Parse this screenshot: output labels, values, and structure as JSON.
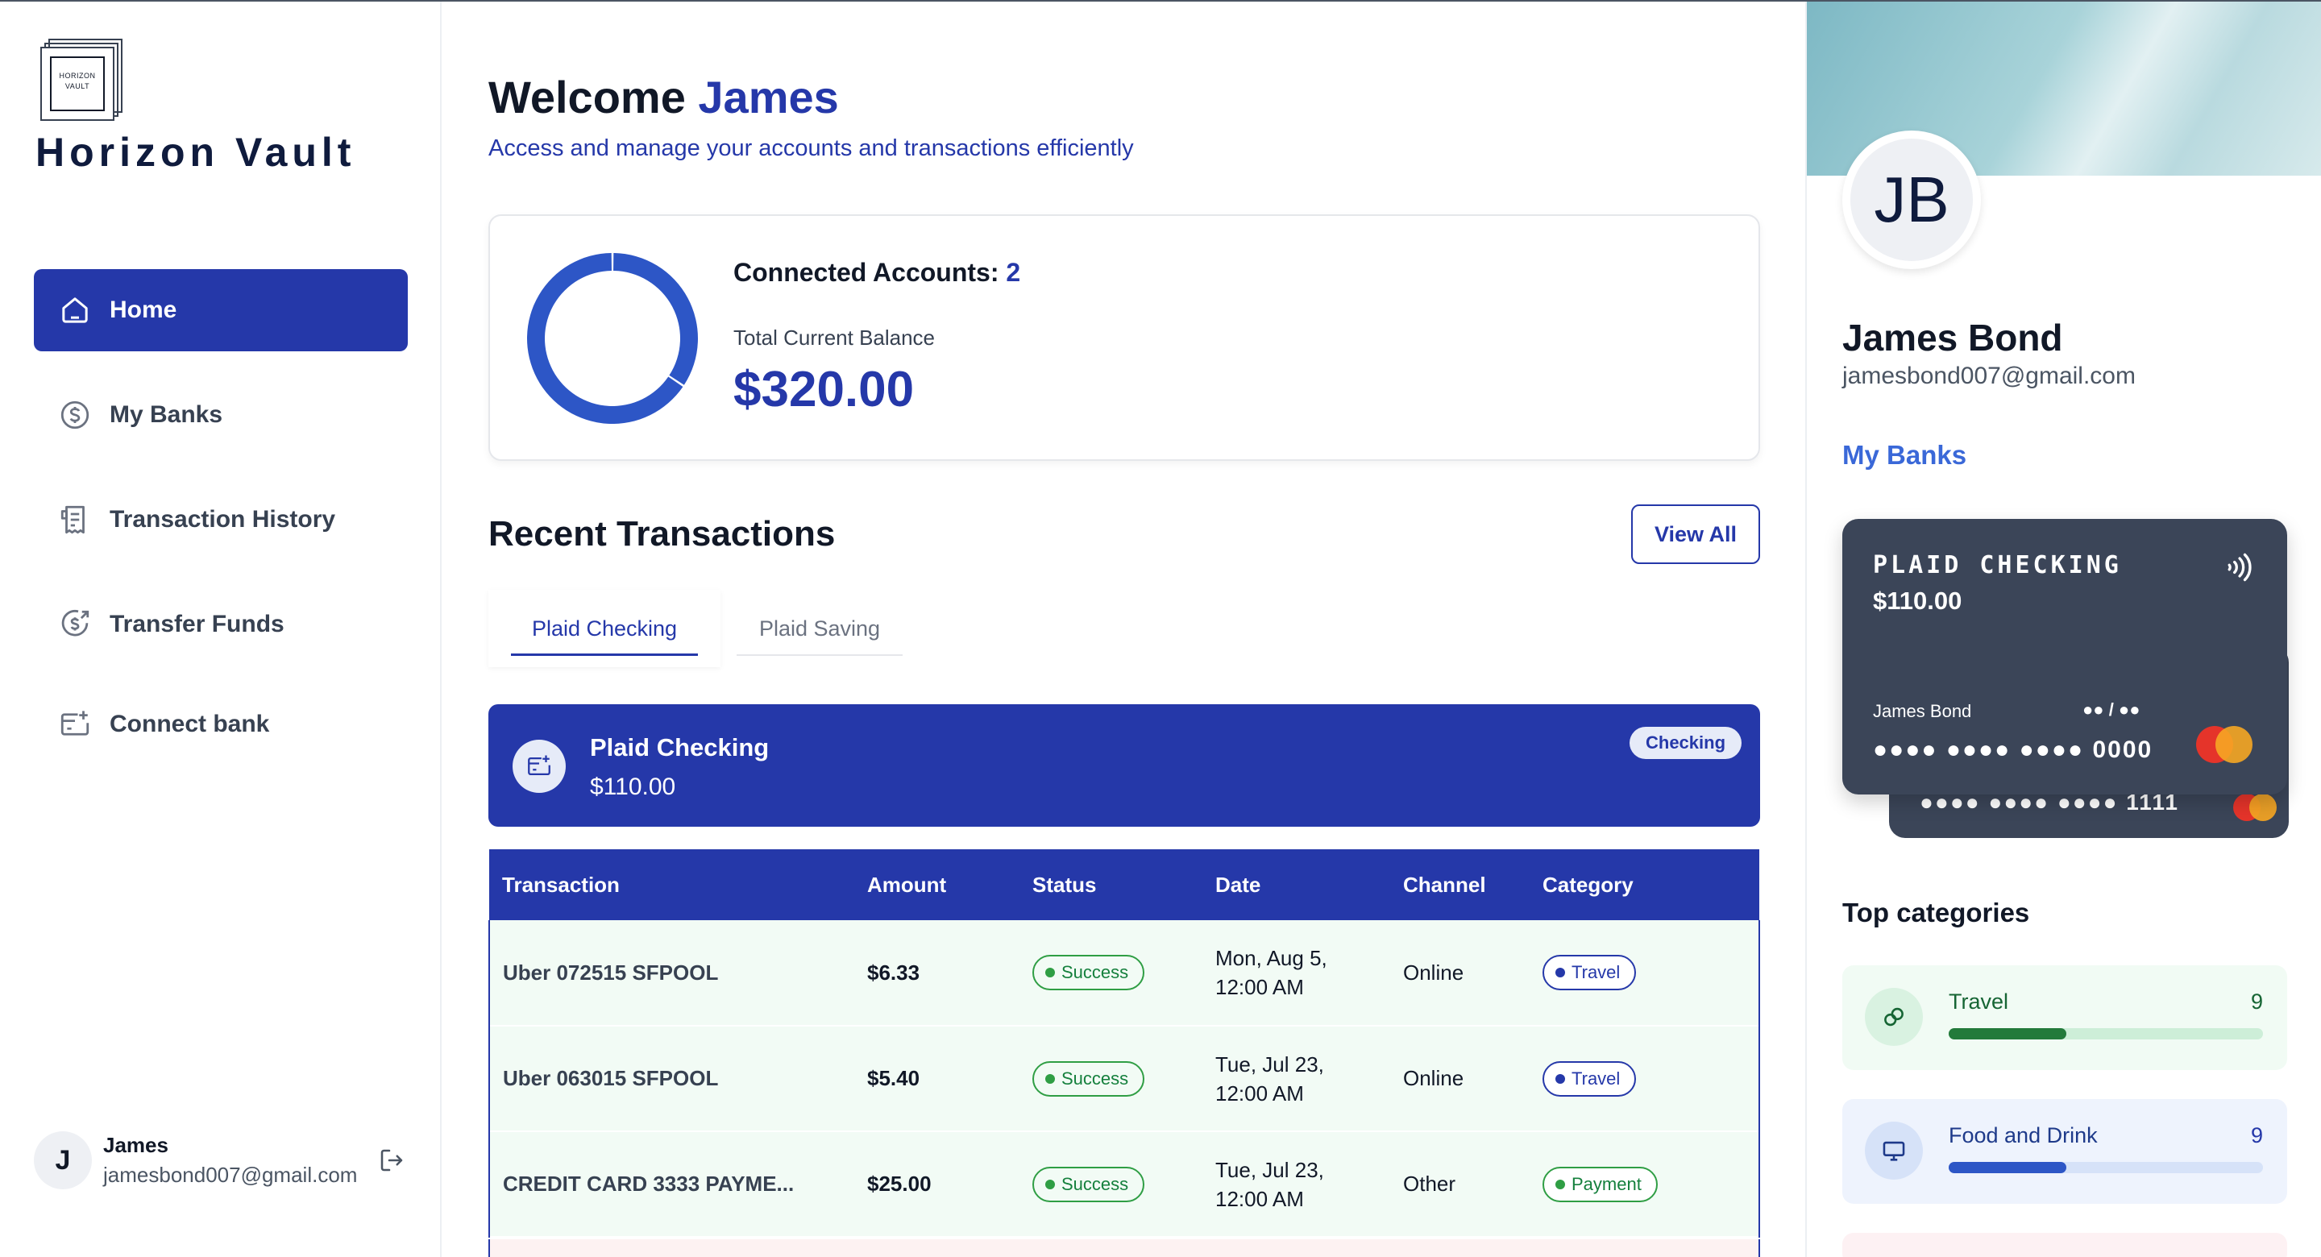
{
  "app": {
    "logo_text": "HORIZON VAULT",
    "name": "Horizon Vault"
  },
  "colors": {
    "primary": "#2538a9",
    "accent": "#3a68d8",
    "success": "#2f9e44",
    "card": "#3b4558"
  },
  "sidebar": {
    "items": [
      {
        "label": "Home",
        "icon": "home-icon",
        "active": true
      },
      {
        "label": "My Banks",
        "icon": "dollar-circle-icon",
        "active": false
      },
      {
        "label": "Transaction History",
        "icon": "receipt-icon",
        "active": false
      },
      {
        "label": "Transfer Funds",
        "icon": "money-send-icon",
        "active": false
      },
      {
        "label": "Connect bank",
        "icon": "connect-bank-icon",
        "active": false
      }
    ],
    "user": {
      "initial": "J",
      "name": "James",
      "email": "jamesbond007@gmail.com"
    }
  },
  "header": {
    "welcome_prefix": "Welcome",
    "user_first_name": "James",
    "subtitle": "Access and manage your accounts and transactions efficiently"
  },
  "balance": {
    "connected_label": "Connected Accounts:",
    "connected_count": "2",
    "total_label": "Total Current Balance",
    "total_amount": "$320.00",
    "donut_shares": [
      0.34375,
      0.65625
    ]
  },
  "recent": {
    "title": "Recent Transactions",
    "view_all": "View All",
    "tabs": [
      "Plaid Checking",
      "Plaid Saving"
    ],
    "account": {
      "name": "Plaid Checking",
      "balance": "$110.00",
      "type": "Checking"
    },
    "columns": [
      "Transaction",
      "Amount",
      "Status",
      "Date",
      "Channel",
      "Category"
    ],
    "rows": [
      {
        "name": "Uber 072515 SFPOOL",
        "amount": "$6.33",
        "status": "Success",
        "date_line1": "Mon, Aug 5,",
        "date_line2": "12:00 AM",
        "channel": "Online",
        "category": "Travel"
      },
      {
        "name": "Uber 063015 SFPOOL",
        "amount": "$5.40",
        "status": "Success",
        "date_line1": "Tue, Jul 23,",
        "date_line2": "12:00 AM",
        "channel": "Online",
        "category": "Travel"
      },
      {
        "name": "CREDIT CARD 3333 PAYME...",
        "amount": "$25.00",
        "status": "Success",
        "date_line1": "Tue, Jul 23,",
        "date_line2": "12:00 AM",
        "channel": "Other",
        "category": "Payment"
      }
    ]
  },
  "profile": {
    "initials": "JB",
    "name": "James Bond",
    "email": "jamesbond007@gmail.com",
    "banks_title": "My Banks",
    "card_front": {
      "bank": "PLAID CHECKING",
      "balance": "$110.00",
      "holder": "James Bond",
      "expiry": "●● / ●●",
      "number": "●●●● ●●●● ●●●● 0000"
    },
    "card_back": {
      "number": "●●●● ●●●● ●●●● 1111"
    },
    "top_categories_title": "Top categories",
    "categories": [
      {
        "name": "Travel",
        "count": "9",
        "progress": 0.375,
        "icon": "link-icon"
      },
      {
        "name": "Food and Drink",
        "count": "9",
        "progress": 0.375,
        "icon": "monitor-icon"
      }
    ]
  }
}
